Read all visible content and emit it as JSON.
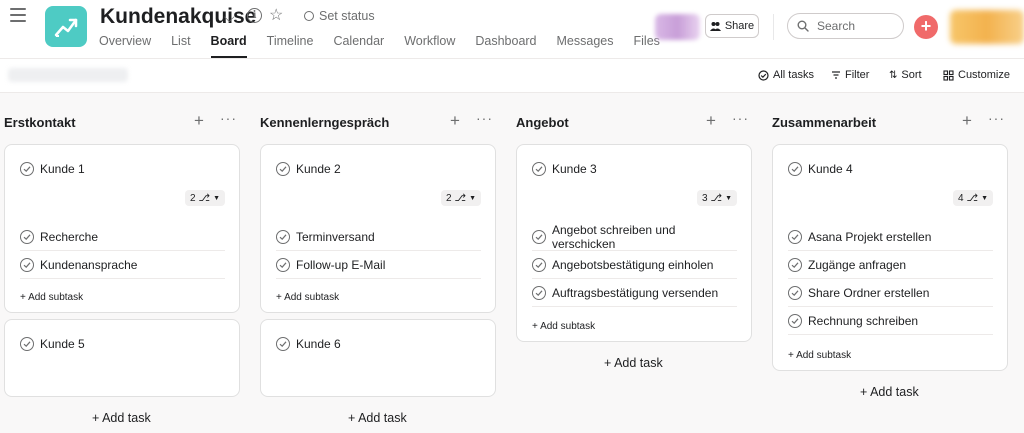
{
  "project": {
    "title": "Kundenakquise",
    "set_status": "Set status",
    "icon": "chart-icon",
    "color": "#4ecbc4"
  },
  "tabs": [
    {
      "label": "Overview",
      "active": false
    },
    {
      "label": "List",
      "active": false
    },
    {
      "label": "Board",
      "active": true
    },
    {
      "label": "Timeline",
      "active": false
    },
    {
      "label": "Calendar",
      "active": false
    },
    {
      "label": "Workflow",
      "active": false
    },
    {
      "label": "Dashboard",
      "active": false
    },
    {
      "label": "Messages",
      "active": false
    },
    {
      "label": "Files",
      "active": false
    }
  ],
  "header": {
    "share_label": "Share",
    "search_placeholder": "Search",
    "create_color": "#f06a6a"
  },
  "toolbar": {
    "all_tasks": "All tasks",
    "filter": "Filter",
    "sort": "Sort",
    "customize": "Customize"
  },
  "columns": [
    {
      "title": "Erstkontakt",
      "add_task": "+ Add task",
      "cards": [
        {
          "title": "Kunde 1",
          "subtask_count": "2",
          "subtasks": [
            "Recherche",
            "Kundenansprache"
          ],
          "add_subtask": "+ Add subtask"
        },
        {
          "title": "Kunde 5",
          "subtask_count": "",
          "subtasks": [],
          "add_subtask": ""
        }
      ]
    },
    {
      "title": "Kennenlerngespräch",
      "add_task": "+ Add task",
      "cards": [
        {
          "title": "Kunde 2",
          "subtask_count": "2",
          "subtasks": [
            "Terminversand",
            "Follow-up E-Mail"
          ],
          "add_subtask": "+ Add subtask"
        },
        {
          "title": "Kunde 6",
          "subtask_count": "",
          "subtasks": [],
          "add_subtask": ""
        }
      ]
    },
    {
      "title": "Angebot",
      "add_task": "+ Add task",
      "cards": [
        {
          "title": "Kunde 3",
          "subtask_count": "3",
          "subtasks": [
            "Angebot schreiben und verschicken",
            "Angebotsbestätigung einholen",
            "Auftragsbestätigung versenden"
          ],
          "add_subtask": "+ Add subtask"
        }
      ]
    },
    {
      "title": "Zusammenarbeit",
      "add_task": "+ Add task",
      "cards": [
        {
          "title": "Kunde 4",
          "subtask_count": "4",
          "subtasks": [
            "Asana Projekt erstellen",
            "Zugänge anfragen",
            "Share Ordner erstellen",
            "Rechnung schreiben"
          ],
          "add_subtask": "+ Add subtask"
        }
      ]
    }
  ]
}
